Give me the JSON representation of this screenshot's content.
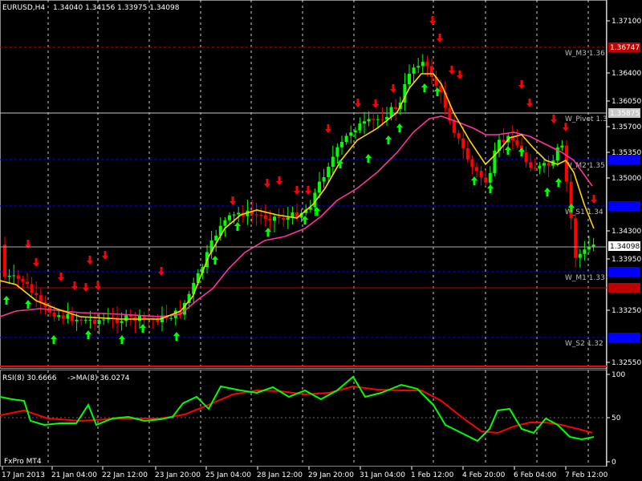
{
  "header": {
    "symbol": "EURUSD,H4",
    "ohlc": "1.34040 1.34156 1.33975 1.34098"
  },
  "rsi_header": {
    "label": "RSI(8) 30.6666",
    "ma_label": "->MA(8) 36.0274"
  },
  "broker": "FxPro MT4",
  "price_axis": {
    "ticks": [
      "1.37100",
      "1.36400",
      "1.36050",
      "1.35700",
      "1.35350",
      "1.35000",
      "1.34300",
      "1.33950",
      "1.33250",
      "1.32550"
    ],
    "current_price": "1.34098"
  },
  "rsi_axis": {
    "ticks": [
      "100",
      "50",
      "0"
    ]
  },
  "time_axis": {
    "labels": [
      "17 Jan 2013",
      "21 Jan 04:00",
      "22 Jan 12:00",
      "23 Jan 20:00",
      "25 Jan 04:00",
      "28 Jan 12:00",
      "29 Jan 20:00",
      "31 Jan 04:00",
      "1 Feb 12:00",
      "4 Feb 20:00",
      "6 Feb 04:00",
      "7 Feb 12:00"
    ]
  },
  "pivot_levels": [
    {
      "label": "W_M3 1.36",
      "price_tag": "1.36747"
    },
    {
      "label": "W_Pivot 1.3",
      "price_tag": "1.35875"
    },
    {
      "label": "W_M2 1.35",
      "price_tag": ""
    },
    {
      "label": "W_S1 1.34",
      "price_tag": ""
    },
    {
      "label": "W_M1 1.33",
      "price_tag": ""
    },
    {
      "label": "",
      "price_tag": ""
    },
    {
      "label": "W_S2 1.32",
      "price_tag": ""
    }
  ],
  "colors": {
    "background": "#000000",
    "bull_candle": "#00ff00",
    "bear_candle": "#ff0000",
    "fast_ma": "#ffd700",
    "slow_ma": "#ff3399",
    "rsi_line": "#00ff00",
    "rsi_ma": "#ff0000",
    "pivot_red": "#c00000",
    "pivot_blue": "#0000ff",
    "grid": "#ffffff",
    "arrow_up": "#00ff00",
    "arrow_down": "#ff0000"
  }
}
